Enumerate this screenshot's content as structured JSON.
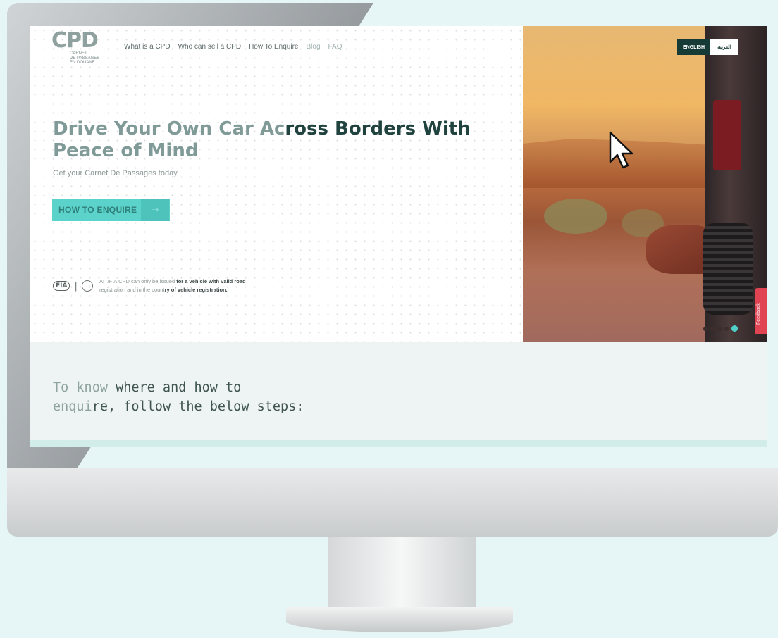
{
  "logo": {
    "mark": "CPD",
    "subtitle_lines": [
      "CARNET",
      "DE PASSAGES",
      "EN DOUANE"
    ]
  },
  "nav": {
    "items": [
      "What is a CPD",
      "Who can sell a CPD",
      "How To Enquire",
      "Blog",
      "FAQ"
    ]
  },
  "hero": {
    "headline_light": "Drive Your Own Car Ac",
    "headline_dark": "ross Borders With",
    "headline_line2": "Peace of Mind",
    "subline": "Get your Carnet De Passages today",
    "cta_label": "HOW TO ENQUIRE",
    "notice_light": "AIT/FIA CPD can only be issued ",
    "notice_bold": "for a vehicle with valid road",
    "notice_line2_light": "registration and in the count",
    "notice_line2_bold": "ry of vehicle registration.",
    "fia_badge": "FIA"
  },
  "language": {
    "english": "ENGLISH",
    "arabic": "العربية"
  },
  "feedback": {
    "label": "Feedback"
  },
  "slider": {
    "count": 5,
    "active_index": 4
  },
  "steps": {
    "title_light": "To know ",
    "title_dark": "where and how to",
    "title_line2_light": "enqui",
    "title_line2_dark": "re, follow the below steps:"
  },
  "colors": {
    "accent": "#5bd3cb",
    "dark": "#163b37",
    "feedback": "#e04452"
  }
}
